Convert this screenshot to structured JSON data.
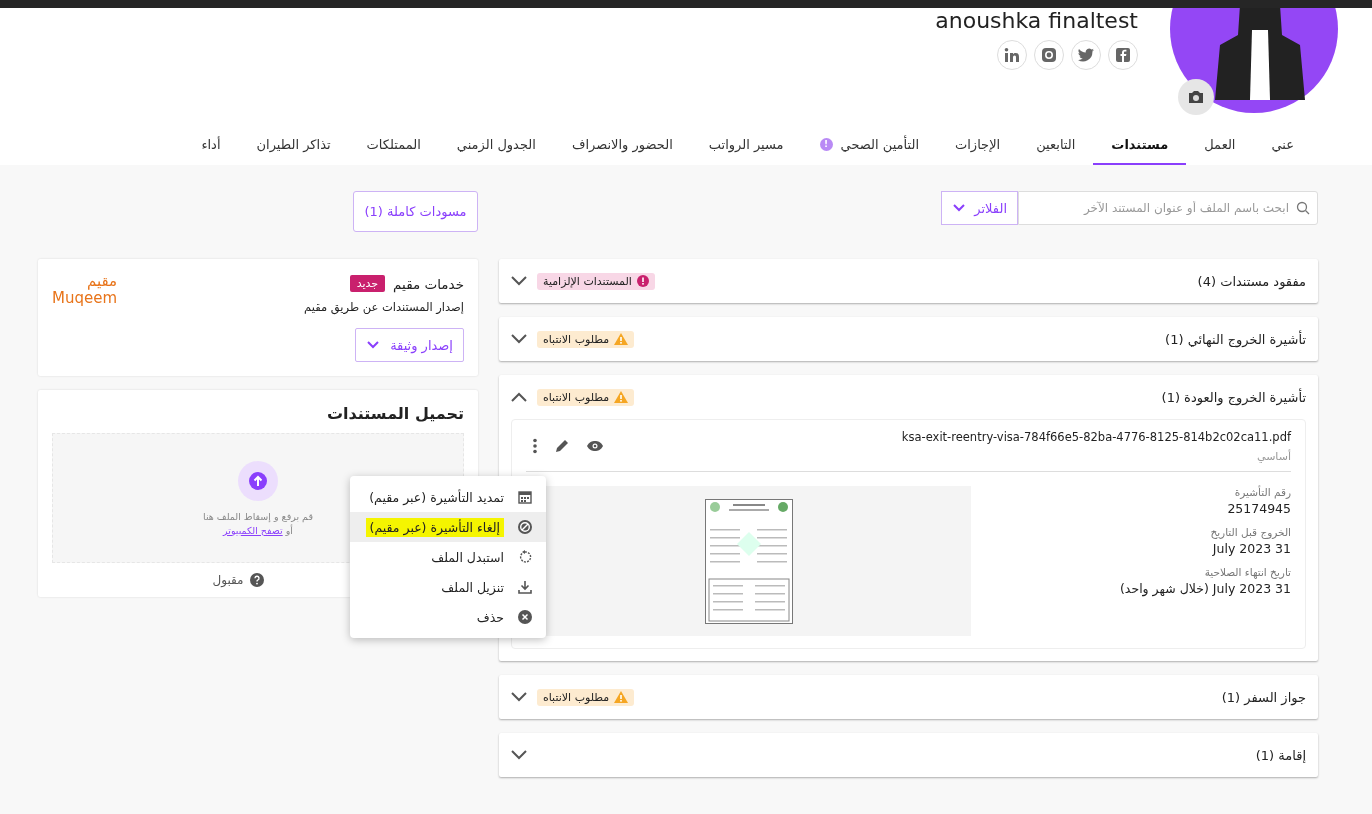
{
  "profile": {
    "name": "anoushka finaltest"
  },
  "tabs": [
    {
      "label": "عني",
      "selected": false
    },
    {
      "label": "العمل",
      "selected": false
    },
    {
      "label": "مستندات",
      "selected": true
    },
    {
      "label": "التابعين",
      "selected": false
    },
    {
      "label": "الإجازات",
      "selected": false
    },
    {
      "label": "التأمين الصحي",
      "selected": false,
      "badge": "!"
    },
    {
      "label": "مسير الرواتب",
      "selected": false
    },
    {
      "label": "الحضور والانصراف",
      "selected": false
    },
    {
      "label": "الجدول الزمني",
      "selected": false
    },
    {
      "label": "الممتلكات",
      "selected": false
    },
    {
      "label": "تذاكر الطيران",
      "selected": false
    },
    {
      "label": "أداء",
      "selected": false
    }
  ],
  "search": {
    "placeholder": "ابحث باسم الملف أو عنوان المستند الآخر",
    "filter_button": "الفلاتر"
  },
  "drafts_button": "مسودات كاملة (1)",
  "sections": [
    {
      "title": "مفقود مستندات (4)",
      "expanded": false,
      "tag": {
        "kind": "required",
        "label": "المستندات الإلزامية"
      }
    },
    {
      "title": "تأشيرة الخروج النهائي (1)",
      "expanded": false,
      "tag": {
        "kind": "attention",
        "label": "مطلوب الانتباه"
      }
    },
    {
      "title": "تأشيرة الخروج والعودة (1)",
      "expanded": true,
      "tag": {
        "kind": "attention",
        "label": "مطلوب الانتباه"
      },
      "document": {
        "filename": "ksa-exit-reentry-visa-784f66e5-82ba-4776-8125-814b2c02ca11.pdf",
        "category": "أساسي",
        "fields": [
          {
            "label": "رقم التأشيرة",
            "value": "25174945"
          },
          {
            "label": "الخروج قبل التاريخ",
            "value": "July 2023 31"
          },
          {
            "label": "تاريخ انتهاء الصلاحية",
            "value": "July 2023 31 (خلال شهر واحد)"
          }
        ]
      }
    },
    {
      "title": "جواز السفر (1)",
      "expanded": false,
      "tag": {
        "kind": "attention",
        "label": "مطلوب الانتباه"
      }
    },
    {
      "title": "إقامة (1)",
      "expanded": false
    }
  ],
  "muqeem": {
    "title": "خدمات مقيم",
    "badge": "جديد",
    "description": "إصدار المستندات عن طريق مقيم",
    "logo_ar": "مقيم",
    "logo_en": "Muqeem",
    "issue_button": "إصدار وثيقة"
  },
  "upload": {
    "title": "تحميل المستندات",
    "prompt": "قم برفع و إسقاط الملف هنا",
    "or": "أو",
    "browse_link": "تصفح الكمبيوتر",
    "accepted": "مقبول"
  },
  "context_menu": [
    {
      "kind": "calendar",
      "label": "تمديد التأشيرة (عبر مقيم)",
      "hovered": false,
      "highlighted": false
    },
    {
      "kind": "cancel",
      "label": "إلغاء التأشيرة (عبر مقيم)",
      "hovered": true,
      "highlighted": true
    },
    {
      "kind": "replace",
      "label": "استبدل الملف",
      "hovered": false,
      "highlighted": false
    },
    {
      "kind": "download",
      "label": "تنزيل الملف",
      "hovered": false,
      "highlighted": false
    },
    {
      "kind": "delete",
      "label": "حذف",
      "hovered": false,
      "highlighted": false
    }
  ]
}
